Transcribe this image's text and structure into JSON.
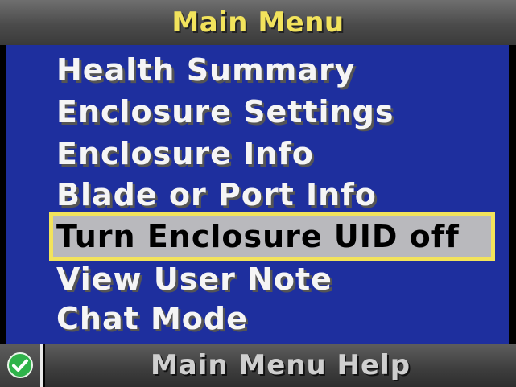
{
  "header": {
    "title": "Main Menu"
  },
  "menu": {
    "items": [
      {
        "label": "Health Summary"
      },
      {
        "label": "Enclosure Settings"
      },
      {
        "label": "Enclosure Info"
      },
      {
        "label": "Blade or Port Info"
      },
      {
        "label": "Turn Enclosure UID off",
        "selected": true
      },
      {
        "label": "View User Note"
      },
      {
        "label": "Chat Mode"
      }
    ]
  },
  "status_bar": {
    "status_icon": "check-circle-icon",
    "status_color": "#2fb34a",
    "help_label": "Main Menu Help"
  },
  "colors": {
    "title_text": "#f2e35c",
    "menu_background": "#1e2f9e",
    "selection_border": "#f2e35c",
    "selection_fill": "#b9b9bd",
    "menu_text": "#f5f5f5"
  }
}
